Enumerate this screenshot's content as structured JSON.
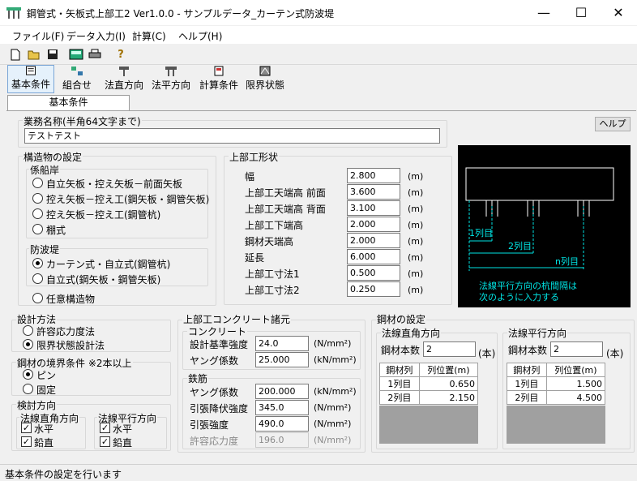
{
  "window": {
    "title": "鋼管式・矢板式上部工2 Ver1.0.0 - サンプルデータ_カーテン式防波堤",
    "minimize": "—",
    "maximize": "☐",
    "close": "✕"
  },
  "menu": [
    "ファイル(F)",
    "データ入力(I)",
    "計算(C)",
    "ヘルプ(H)"
  ],
  "toolbar_icons": [
    "new-file-icon",
    "open-folder-icon",
    "save-disk-icon",
    "calc-icon",
    "print-icon",
    "help-question-icon"
  ],
  "toolbar2": [
    "基本条件",
    "組合せ",
    "法直方向",
    "法平方向",
    "計算条件",
    "限界状態"
  ],
  "tab": "基本条件",
  "help_button": "ヘルプ",
  "project": {
    "label": "業務名称(半角64文字まで)",
    "value": "テストテスト"
  },
  "structure": {
    "label": "構造物の設定",
    "mooring_label": "係船岸",
    "mooring_options": [
      "自立矢板・控え矢板－前面矢板",
      "控え矢板－控え工(鋼矢板・鋼管矢板)",
      "控え矢板－控え工(鋼管杭)",
      "棚式"
    ],
    "breakwater_label": "防波堤",
    "breakwater_options": [
      "カーテン式・自立式(鋼管杭)",
      "自立式(鋼矢板・鋼管矢板)"
    ],
    "other_option": "任意構造物"
  },
  "shape": {
    "label": "上部工形状",
    "rows": [
      {
        "label": "幅",
        "value": "2.800",
        "unit": "(m)"
      },
      {
        "label": "上部工天端高  前面",
        "value": "3.600",
        "unit": "(m)"
      },
      {
        "label": "上部工天端高  背面",
        "value": "3.100",
        "unit": "(m)"
      },
      {
        "label": "上部工下端高",
        "value": "2.000",
        "unit": "(m)"
      },
      {
        "label": "鋼材天端高",
        "value": "2.000",
        "unit": "(m)"
      },
      {
        "label": "延長",
        "value": "6.000",
        "unit": "(m)"
      },
      {
        "label": "上部工寸法1",
        "value": "0.500",
        "unit": "(m)"
      },
      {
        "label": "上部工寸法2",
        "value": "0.250",
        "unit": "(m)"
      }
    ]
  },
  "diagram": {
    "labels": [
      "1列目",
      "2列目",
      "n列目"
    ],
    "note1": "法線平行方向の杭間隔は",
    "note2": "次のように入力する",
    "color": "#00e5e5"
  },
  "design_method": {
    "label": "設計方法",
    "options": [
      "許容応力度法",
      "限界状態設計法"
    ]
  },
  "boundary": {
    "label": "鋼材の境界条件  ※2本以上",
    "options": [
      "ピン",
      "固定"
    ]
  },
  "review": {
    "label": "検討方向",
    "normal_label": "法線直角方向",
    "parallel_label": "法線平行方向",
    "horizontal": "水平",
    "vertical": "鉛直"
  },
  "concrete": {
    "label": "上部工コンクリート諸元",
    "sub": "コンクリート",
    "rows": [
      {
        "label": "設計基準強度",
        "value": "24.0",
        "unit": "(N/mm²)"
      },
      {
        "label": "ヤング係数",
        "value": "25.000",
        "unit": "(kN/mm²)"
      }
    ],
    "rebar_sub": "鉄筋",
    "rebar_rows": [
      {
        "label": "ヤング係数",
        "value": "200.000",
        "unit": "(kN/mm²)"
      },
      {
        "label": "引張降伏強度",
        "value": "345.0",
        "unit": "(N/mm²)"
      },
      {
        "label": "引張強度",
        "value": "490.0",
        "unit": "(N/mm²)"
      },
      {
        "label": "許容応力度",
        "value": "196.0",
        "unit": "(N/mm²)"
      }
    ]
  },
  "steel": {
    "label": "鋼材の設定",
    "normal": {
      "label": "法線直角方向",
      "count_label": "鋼材本数",
      "count": "2",
      "count_unit": "(本)",
      "headers": [
        "鋼材列",
        "列位置(m)"
      ],
      "rows": [
        [
          "1列目",
          "0.650"
        ],
        [
          "2列目",
          "2.150"
        ]
      ]
    },
    "parallel": {
      "label": "法線平行方向",
      "count_label": "鋼材本数",
      "count": "2",
      "count_unit": "(本)",
      "headers": [
        "鋼材列",
        "列位置(m)"
      ],
      "rows": [
        [
          "1列目",
          "1.500"
        ],
        [
          "2列目",
          "4.500"
        ]
      ]
    }
  },
  "status": "基本条件の設定を行います"
}
